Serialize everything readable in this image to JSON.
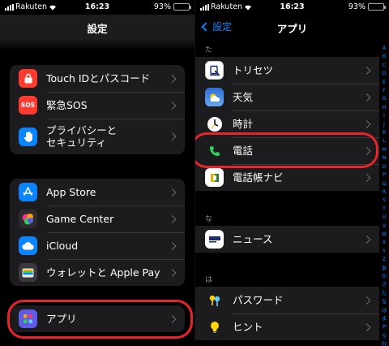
{
  "status_left": {
    "carrier": "Rakuten",
    "time": "16:23",
    "battery": "93%"
  },
  "status_right": {
    "carrier": "Rakuten",
    "time": "16:23",
    "battery": "93%"
  },
  "settings": {
    "title": "設定",
    "group1": [
      {
        "label": "Touch IDとパスコード",
        "icon": "fingerprint-icon",
        "color": "#ff3b30"
      },
      {
        "label": "緊急SOS",
        "icon": "sos-icon",
        "icon_text": "SOS",
        "color": "#ff3b30"
      },
      {
        "label": "プライバシーと\nセキュリティ",
        "icon": "hand-icon",
        "color": "#0a84ff"
      }
    ],
    "group2": [
      {
        "label": "App Store",
        "icon": "app-store-icon",
        "color": "#0a84ff"
      },
      {
        "label": "Game Center",
        "icon": "game-center-icon",
        "color": "#2c2c2e"
      },
      {
        "label": "iCloud",
        "icon": "icloud-icon",
        "color": "#0a84ff"
      },
      {
        "label": "ウォレットと Apple Pay",
        "icon": "wallet-icon",
        "color": "#3a3a3c"
      }
    ],
    "group3": [
      {
        "label": "アプリ",
        "icon": "apps-icon",
        "color": "#5e5ce6"
      }
    ]
  },
  "apps": {
    "back_label": "設定",
    "title": "アプリ",
    "sections": [
      {
        "header": "た",
        "items": [
          {
            "label": "トリセツ",
            "icon": "torisetsu-icon",
            "color": "#ffffff"
          },
          {
            "label": "天気",
            "icon": "weather-icon",
            "color": "#2f6fd6"
          },
          {
            "label": "時計",
            "icon": "clock-icon",
            "color": "#1c1c1e"
          },
          {
            "label": "電話",
            "icon": "phone-icon",
            "color": "#1c1c1e"
          },
          {
            "label": "電話帳ナビ",
            "icon": "phonebook-navi-icon",
            "color": "#ffffff"
          }
        ]
      },
      {
        "header": "な",
        "items": [
          {
            "label": "ニュース",
            "icon": "news-icon",
            "color": "#ffffff"
          }
        ]
      },
      {
        "header": "は",
        "items": [
          {
            "label": "パスワード",
            "icon": "passwords-icon",
            "color": "#1c1c1e"
          },
          {
            "label": "ヒント",
            "icon": "tips-icon",
            "color": "#1c1c1e"
          }
        ]
      }
    ],
    "index": [
      "A",
      "B",
      "C",
      "D",
      "E",
      "F",
      "G",
      "H",
      "I",
      "J",
      "K",
      "L",
      "M",
      "N",
      "O",
      "P",
      "Q",
      "R",
      "S",
      "T",
      "U",
      "V",
      "W",
      "X",
      "Y",
      "Z",
      "あ",
      "か",
      "さ",
      "た",
      "な",
      "は",
      "ま",
      "や",
      "ら",
      "わ",
      "#"
    ]
  },
  "highlight_color": "#e8232b"
}
